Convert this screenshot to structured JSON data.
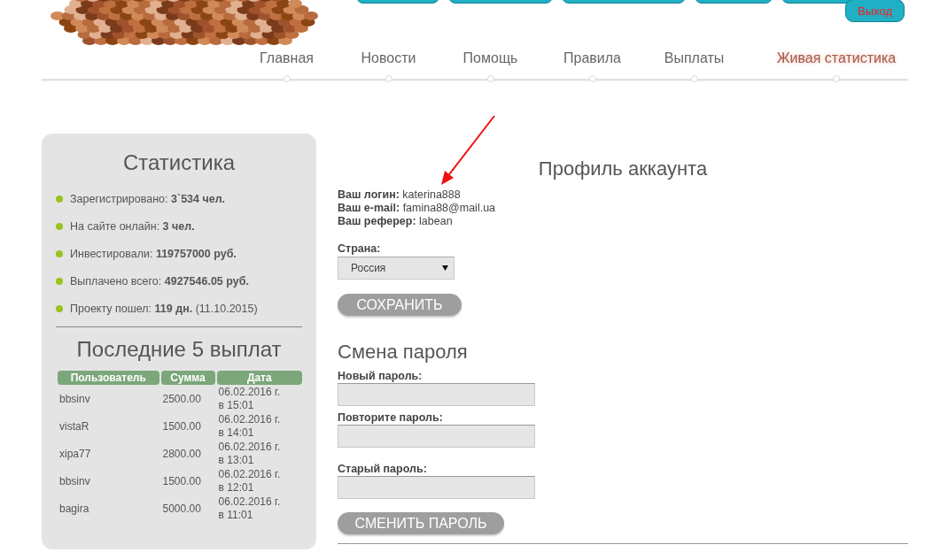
{
  "header": {
    "logout": "Выход"
  },
  "nav": [
    {
      "label": "Главная",
      "selected": false
    },
    {
      "label": "Новости",
      "selected": false
    },
    {
      "label": "Помощь",
      "selected": false
    },
    {
      "label": "Правила",
      "selected": false
    },
    {
      "label": "Выплаты",
      "selected": false
    },
    {
      "label": "Живая статистика",
      "selected": true
    }
  ],
  "stats": {
    "title": "Статистика",
    "items": [
      "Зарегистрировано: **3`534 чел.**",
      "На сайте онлайн: **3 чел.**",
      "Инвестировали: **119757000 руб.**",
      "Выплачено всего: **4927546.05 руб.**",
      "Проекту пошел: **119 дн.** (11.10.2015)"
    ]
  },
  "payouts": {
    "title": "Последние 5 выплат",
    "columns": [
      "Пользователь",
      "Сумма",
      "Дата"
    ],
    "rows": [
      {
        "user": "bbsinv",
        "amount": "2500.00",
        "date": "06.02.2016 г.",
        "time": "в 15:01"
      },
      {
        "user": "vistaR",
        "amount": "1500.00",
        "date": "06.02.2016 г.",
        "time": "в 14:01"
      },
      {
        "user": "xipa77",
        "amount": "2800.00",
        "date": "06.02.2016 г.",
        "time": "в 13:01"
      },
      {
        "user": "bbsinv",
        "amount": "1500.00",
        "date": "06.02.2016 г.",
        "time": "в 12:01"
      },
      {
        "user": "bagira",
        "amount": "5000.00",
        "date": "06.02.2016 г.",
        "time": "в 11:01"
      }
    ]
  },
  "profile": {
    "title": "Профиль аккаунта",
    "fields": [
      "**Ваш логин:** katerina888",
      "**Ваш e-mail:** famina88@mail.ua",
      "**Ваш реферер:** labean"
    ],
    "country": {
      "label": "Страна:",
      "value": "Россия"
    },
    "save": "СОХРАНИТЬ"
  },
  "password": {
    "title": "Смена пароля",
    "fields": [
      {
        "label": "Новый пароль:"
      },
      {
        "label": "Повторите пароль:"
      },
      {
        "label": "Старый пароль:"
      }
    ],
    "submit": "СМЕНИТЬ ПАРОЛЬ"
  }
}
